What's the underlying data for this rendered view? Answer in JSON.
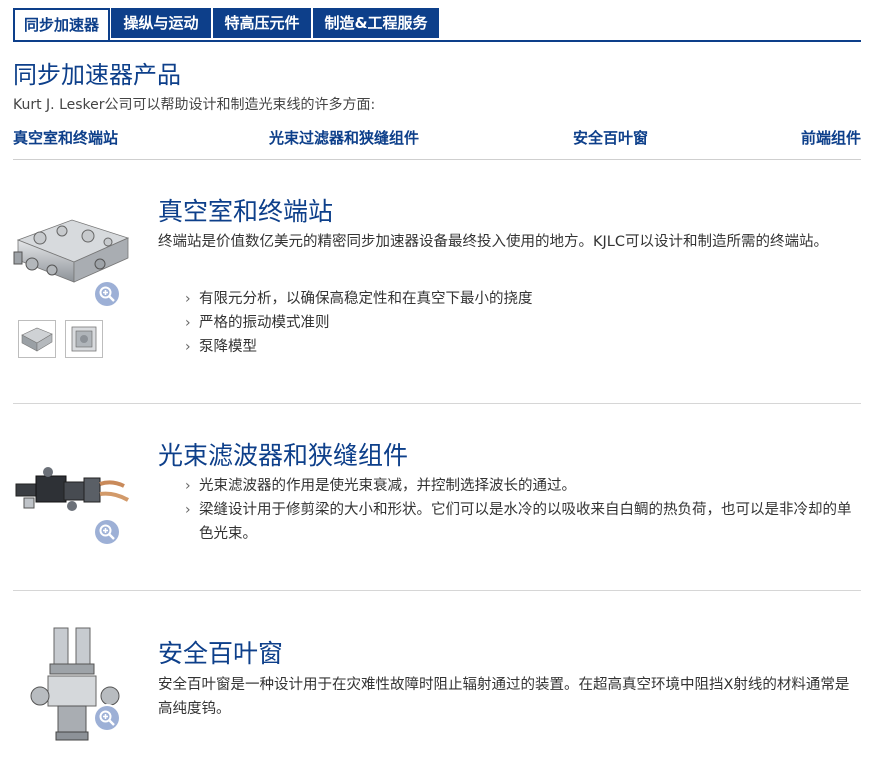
{
  "tabs": [
    "同步加速器",
    "操纵与运动",
    "特高压元件",
    "制造&工程服务"
  ],
  "active_tab": 0,
  "page": {
    "title": "同步加速器产品",
    "intro": "Kurt J. Lesker公司可以帮助设计和制造光束线的许多方面:"
  },
  "quick_links": [
    "真空室和终端站",
    "光束过滤器和狭缝组件",
    "安全百叶窗",
    "前端组件"
  ],
  "sections": [
    {
      "title": "真空室和终端站",
      "description": "终端站是价值数亿美元的精密同步加速器设备最终投入使用的地方。KJLC可以设计和制造所需的终端站。",
      "bullets": [
        "有限元分析，以确保高稳定性和在真空下最小的挠度",
        "严格的振动模式准则",
        "泵降模型"
      ]
    },
    {
      "title": "光束滤波器和狭缝组件",
      "bullets": [
        "光束滤波器的作用是使光束衰减，并控制选择波长的通过。",
        "梁缝设计用于修剪梁的大小和形状。它们可以是水冷的以吸收来自白鲷的热负荷，也可以是非冷却的单色光束。"
      ]
    },
    {
      "title": "安全百叶窗",
      "description": "安全百叶窗是一种设计用于在灾难性故障时阻止辐射通过的装置。在超高真空环境中阻挡X射线的材料通常是高纯度钨。"
    }
  ],
  "icons": {
    "zoom": "magnifier-plus-icon",
    "bullet": "chevron-right-icon"
  },
  "colors": {
    "brand_blue": "#0d3f8a",
    "zoom_badge": "#9db0d6",
    "divider": "#d6d6d6"
  }
}
